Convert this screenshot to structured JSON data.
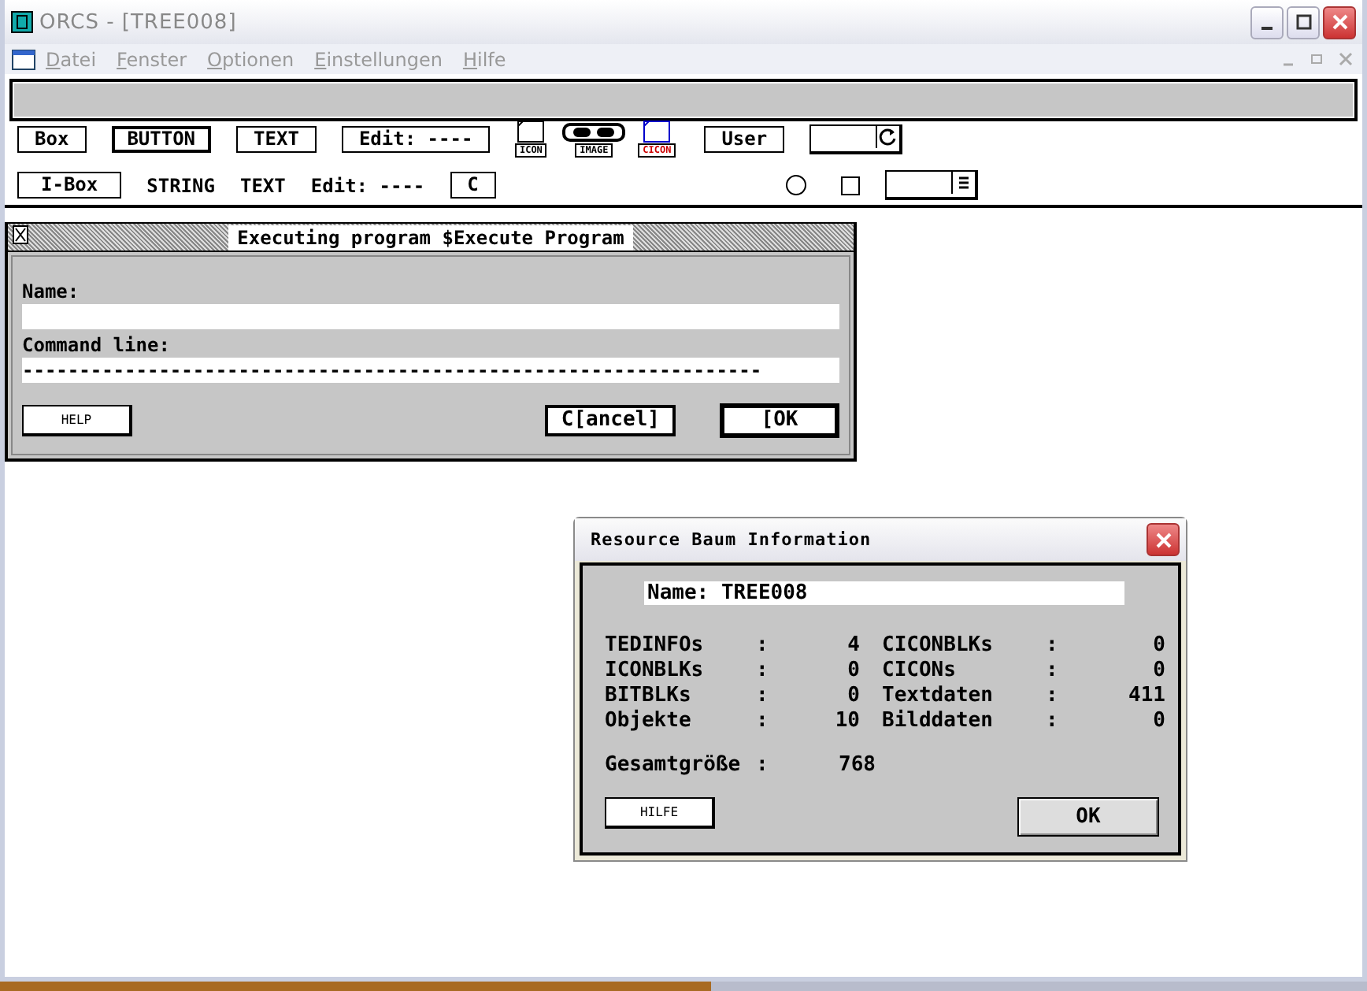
{
  "window": {
    "title": "ORCS - [TREE008]"
  },
  "menu": [
    {
      "label": "Datei",
      "disabled": true
    },
    {
      "label": "Fenster",
      "disabled": true
    },
    {
      "label": "Optionen",
      "disabled": true
    },
    {
      "label": "Einstellungen",
      "disabled": true
    },
    {
      "label": "Hilfe",
      "disabled": true
    }
  ],
  "palette_rows": [
    [
      {
        "kind": "box",
        "label": "Box"
      },
      {
        "kind": "button",
        "label": "BUTTON"
      },
      {
        "kind": "boxtext",
        "label": "TEXT"
      },
      {
        "kind": "edit",
        "label": "Edit: ----"
      },
      {
        "kind": "icon",
        "label": "ICON"
      },
      {
        "kind": "image",
        "label": "IMAGE"
      },
      {
        "kind": "cicon",
        "label": "CICON"
      },
      {
        "kind": "box",
        "label": "User"
      },
      {
        "kind": "popup-refresh"
      }
    ],
    [
      {
        "kind": "box",
        "label": "I-Box"
      },
      {
        "kind": "plain",
        "label": "STRING"
      },
      {
        "kind": "plain",
        "label": "TEXT"
      },
      {
        "kind": "plain",
        "label": "Edit: ----"
      },
      {
        "kind": "box",
        "label": "C"
      },
      {
        "kind": "radio"
      },
      {
        "kind": "checkbox"
      },
      {
        "kind": "popup-menu"
      }
    ]
  ],
  "execute_dialog": {
    "title": "Executing program $Execute Program",
    "fields": [
      {
        "label": "Name:"
      },
      {
        "label": "Command line:",
        "value": "-----------------------------------------------------------------"
      }
    ],
    "buttons": [
      {
        "label": "HELP",
        "kind": "small"
      },
      {
        "label": "C[ancel]",
        "kind": "normal"
      },
      {
        "label": "[OK",
        "kind": "default"
      }
    ]
  },
  "info_dialog": {
    "title": "Resource Baum Information",
    "name": "Name: TREE008",
    "stats": [
      {
        "label": "TEDINFOs",
        "separator": ":",
        "value": "4"
      },
      {
        "label": "CICONBLKs",
        "separator": ":",
        "value": "0"
      },
      {
        "label": "ICONBLKs",
        "separator": ":",
        "value": "0"
      },
      {
        "label": "CICONs",
        "separator": ":",
        "value": "0"
      },
      {
        "label": "BITBLKs",
        "separator": ":",
        "value": "0"
      },
      {
        "label": "Textdaten",
        "separator": ":",
        "value": "411"
      },
      {
        "label": "Objekte",
        "separator": ":",
        "value": "10"
      },
      {
        "label": "Bilddaten",
        "separator": ":",
        "value": "0"
      }
    ],
    "total": {
      "label": "Gesamtgröße",
      "separator": ":",
      "value": "768"
    },
    "buttons": [
      {
        "label": "HILFE",
        "kind": "small"
      },
      {
        "label": "OK",
        "kind": "xp"
      }
    ]
  }
}
